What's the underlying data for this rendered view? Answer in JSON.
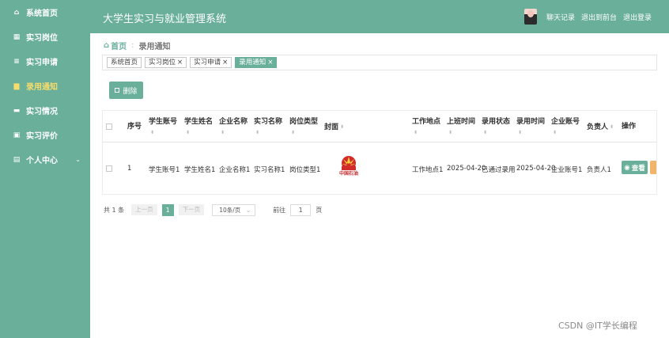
{
  "app": {
    "title": "大学生实习与就业管理系统"
  },
  "header": {
    "chat": "聊天记录",
    "front": "退出到前台",
    "logout": "退出登录"
  },
  "sidebar": {
    "items": [
      {
        "label": "系统首页",
        "icon": "home-icon",
        "glyph": "⌂"
      },
      {
        "label": "实习岗位",
        "icon": "grid-icon",
        "glyph": "▦"
      },
      {
        "label": "实习申请",
        "icon": "list-icon",
        "glyph": "≡"
      },
      {
        "label": "录用通知",
        "icon": "bell-icon",
        "glyph": "▆"
      },
      {
        "label": "实习情况",
        "icon": "ticket-icon",
        "glyph": "▬"
      },
      {
        "label": "实习评价",
        "icon": "briefcase-icon",
        "glyph": "▣"
      },
      {
        "label": "个人中心",
        "icon": "user-center-icon",
        "glyph": "▤"
      }
    ],
    "active_index": 3
  },
  "breadcrumb": {
    "home": "首页",
    "current": "录用通知"
  },
  "tags": [
    {
      "label": "系统首页",
      "closable": false
    },
    {
      "label": "实习岗位",
      "closable": true
    },
    {
      "label": "实习申请",
      "closable": true
    },
    {
      "label": "录用通知",
      "closable": true,
      "active": true
    }
  ],
  "toolbar": {
    "delete_label": "删除"
  },
  "table": {
    "columns": [
      "序号",
      "学生账号",
      "学生姓名",
      "企业名称",
      "实习名称",
      "岗位类型",
      "封面",
      "工作地点",
      "上班时间",
      "录用状态",
      "录用时间",
      "企业账号",
      "负责人",
      "操作"
    ],
    "row": {
      "index": "1",
      "student_account": "学生账号1",
      "student_name": "学生姓名1",
      "company_name": "企业名称1",
      "internship_name": "实习名称1",
      "post_type": "岗位类型1",
      "cover_text": "中国石油",
      "location": "工作地点1",
      "start_time": "2025-04-20",
      "status": "已通过录用",
      "hire_time": "2025-04-20",
      "company_account": "企业账号1",
      "manager": "负责人1",
      "view_label": "查看"
    }
  },
  "pagination": {
    "total": "共 1 条",
    "prev": "上一页",
    "page": "1",
    "next": "下一页",
    "page_size": "10条/页",
    "goto_label": "前往",
    "goto_value": "1",
    "page_unit": "页"
  },
  "watermark": "CSDN @IT学长编程",
  "colors": {
    "primary": "#6aaf9a",
    "active_menu": "#f7dd6b",
    "warning": "#f0b46a"
  }
}
